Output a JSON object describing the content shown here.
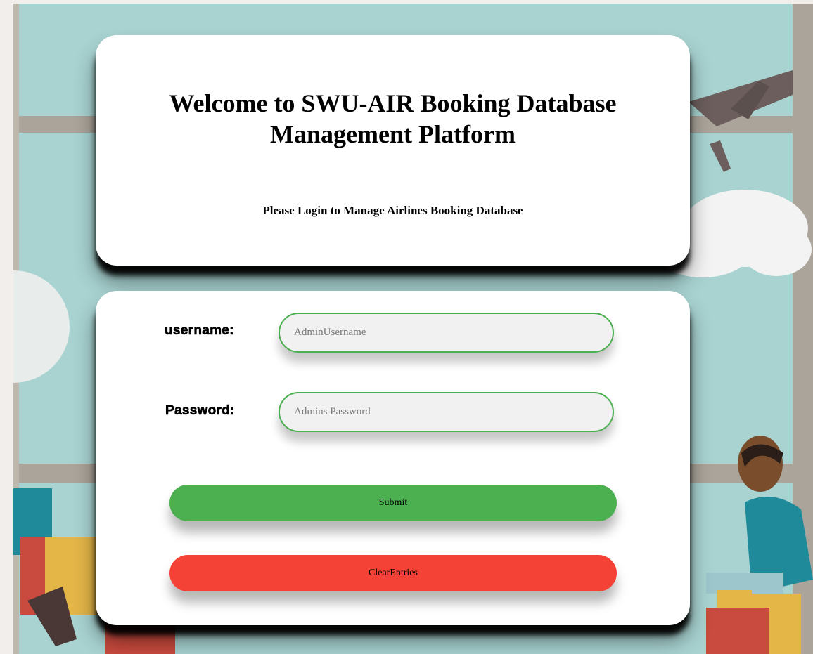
{
  "header": {
    "title": "Welcome to SWU-AIR Booking Database Management Platform",
    "subtitle": "Please Login to Manage Airlines Booking Database"
  },
  "login_form": {
    "username": {
      "label": "username:",
      "placeholder": "AdminUsername",
      "value": ""
    },
    "password": {
      "label": "Password:",
      "placeholder": "Admins Password",
      "value": ""
    },
    "submit_label": "Submit",
    "clear_label": "ClearEntries"
  },
  "colors": {
    "submit": "#4caf50",
    "clear": "#f44336",
    "input_border": "#4caf50",
    "background": "#a8d3d1"
  }
}
